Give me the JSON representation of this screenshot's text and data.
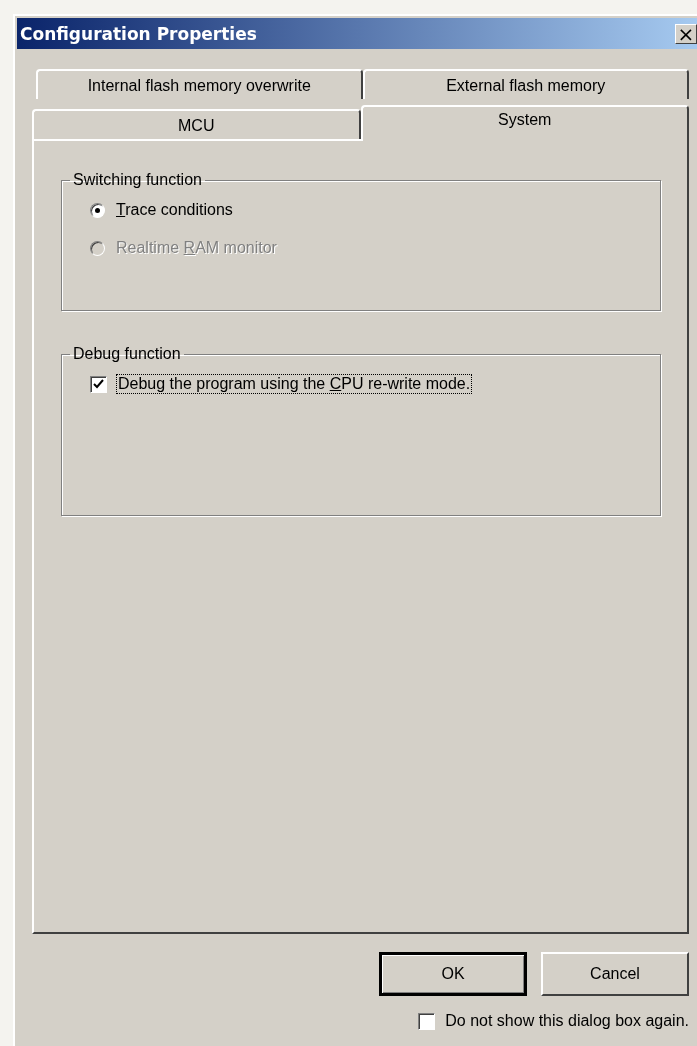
{
  "window": {
    "title": "Configuration Properties",
    "close_glyph": "×"
  },
  "tab_rows": [
    {
      "tabs": [
        {
          "label": "Internal flash memory overwrite",
          "selected": false
        },
        {
          "label": "External flash memory",
          "selected": false
        }
      ]
    },
    {
      "tabs": [
        {
          "label": "MCU",
          "selected": false
        },
        {
          "label": "System",
          "selected": true
        }
      ]
    }
  ],
  "groups": [
    {
      "title": "Switching function",
      "items": [
        {
          "kind": "radio",
          "label": {
            "key": "T",
            "after": "race conditions"
          },
          "selected": true,
          "disabled": false,
          "focused": false
        },
        {
          "kind": "radio",
          "label": {
            "before": "Realtime ",
            "key": "R",
            "after": "AM monitor"
          },
          "selected": false,
          "disabled": true,
          "focused": false
        }
      ]
    },
    {
      "title": "Debug function",
      "items": [
        {
          "kind": "checkbox",
          "label": {
            "before": "Debug the program using the ",
            "key": "C",
            "after": "PU re-write mode."
          },
          "checked": true,
          "disabled": false,
          "focused": true
        }
      ]
    }
  ],
  "buttons": [
    {
      "label": "OK",
      "default": true
    },
    {
      "label": "Cancel",
      "default": false
    }
  ],
  "footer_checkbox": {
    "label": "Do not show this dialog box again.",
    "checked": false
  }
}
